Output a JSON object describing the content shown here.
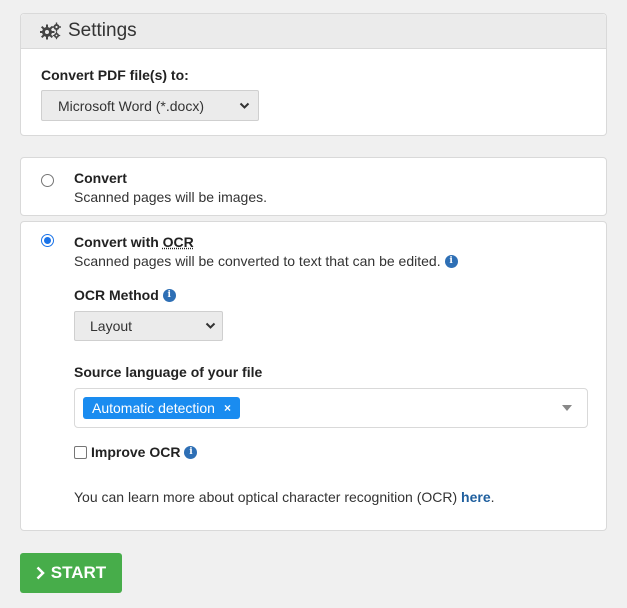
{
  "settings": {
    "title": "Settings",
    "convert_label": "Convert PDF file(s) to:",
    "format_selected": "Microsoft Word (*.docx)"
  },
  "options": {
    "convert": {
      "title": "Convert",
      "description": "Scanned pages will be images.",
      "checked": false
    },
    "ocr": {
      "title_prefix": "Convert with ",
      "title_ocr": "OCR",
      "description": "Scanned pages will be converted to text that can be edited.",
      "checked": true,
      "method_label": "OCR Method",
      "method_selected": "Layout",
      "language_label": "Source language of your file",
      "language_tag": "Automatic detection",
      "improve_label": "Improve OCR",
      "improve_checked": false,
      "learn_more_text": "You can learn more about optical character recognition (OCR) ",
      "learn_more_link": "here",
      "learn_more_suffix": "."
    }
  },
  "start_label": "START",
  "colors": {
    "accent": "#1a73e8",
    "tag": "#1a8cf0",
    "start": "#47ad4a",
    "info": "#2e6fb5",
    "link": "#1f5f9e"
  }
}
